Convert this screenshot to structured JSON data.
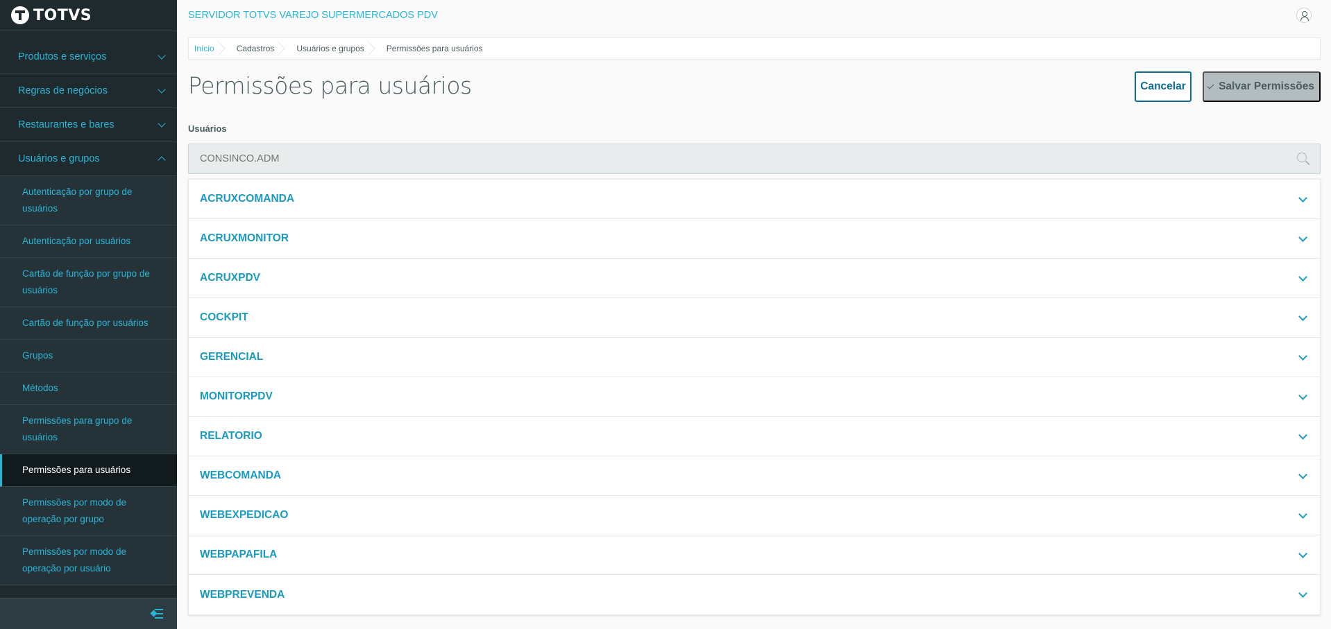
{
  "app": {
    "logo_text": "TOTVS",
    "server_title": "SERVIDOR TOTVS VAREJO SUPERMERCADOS PDV"
  },
  "sidebar": {
    "sections": [
      {
        "label": "Produtos e serviços",
        "expanded": false
      },
      {
        "label": "Regras de negócios",
        "expanded": false
      },
      {
        "label": "Restaurantes e bares",
        "expanded": false
      },
      {
        "label": "Usuários e grupos",
        "expanded": true
      }
    ],
    "subitems": [
      "Autenticação por grupo de usuários",
      "Autenticação por usuários",
      "Cartão de função por grupo de usuários",
      "Cartão de função por usuários",
      "Grupos",
      "Métodos",
      "Permissões para grupo de usuários",
      "Permissões para usuários",
      "Permissões por modo de operação por grupo",
      "Permissões por modo de operação por usuário"
    ],
    "active_subitem": "Permissões para usuários"
  },
  "breadcrumb": [
    "Início",
    "Cadastros",
    "Usuários e grupos",
    "Permissões para usuários"
  ],
  "page": {
    "title": "Permissões para usuários",
    "cancel_label": "Cancelar",
    "save_label": "Salvar Permissões"
  },
  "users_field": {
    "label": "Usuários",
    "placeholder": "CONSINCO.ADM",
    "value": ""
  },
  "accordion": {
    "items": [
      "ACRUXCOMANDA",
      "ACRUXMONITOR",
      "ACRUXPDV",
      "COCKPIT",
      "GERENCIAL",
      "MONITORPDV",
      "RELATORIO",
      "WEBCOMANDA",
      "WEBEXPEDICAO",
      "WEBPAPAFILA",
      "WEBPREVENDA"
    ]
  },
  "colors": {
    "sidebar_bg": "#1e2a2e",
    "accent": "#29b6d6",
    "link": "#1a9ac1",
    "primary": "#0c6c94",
    "disabled_button": "#b3bcbe"
  }
}
